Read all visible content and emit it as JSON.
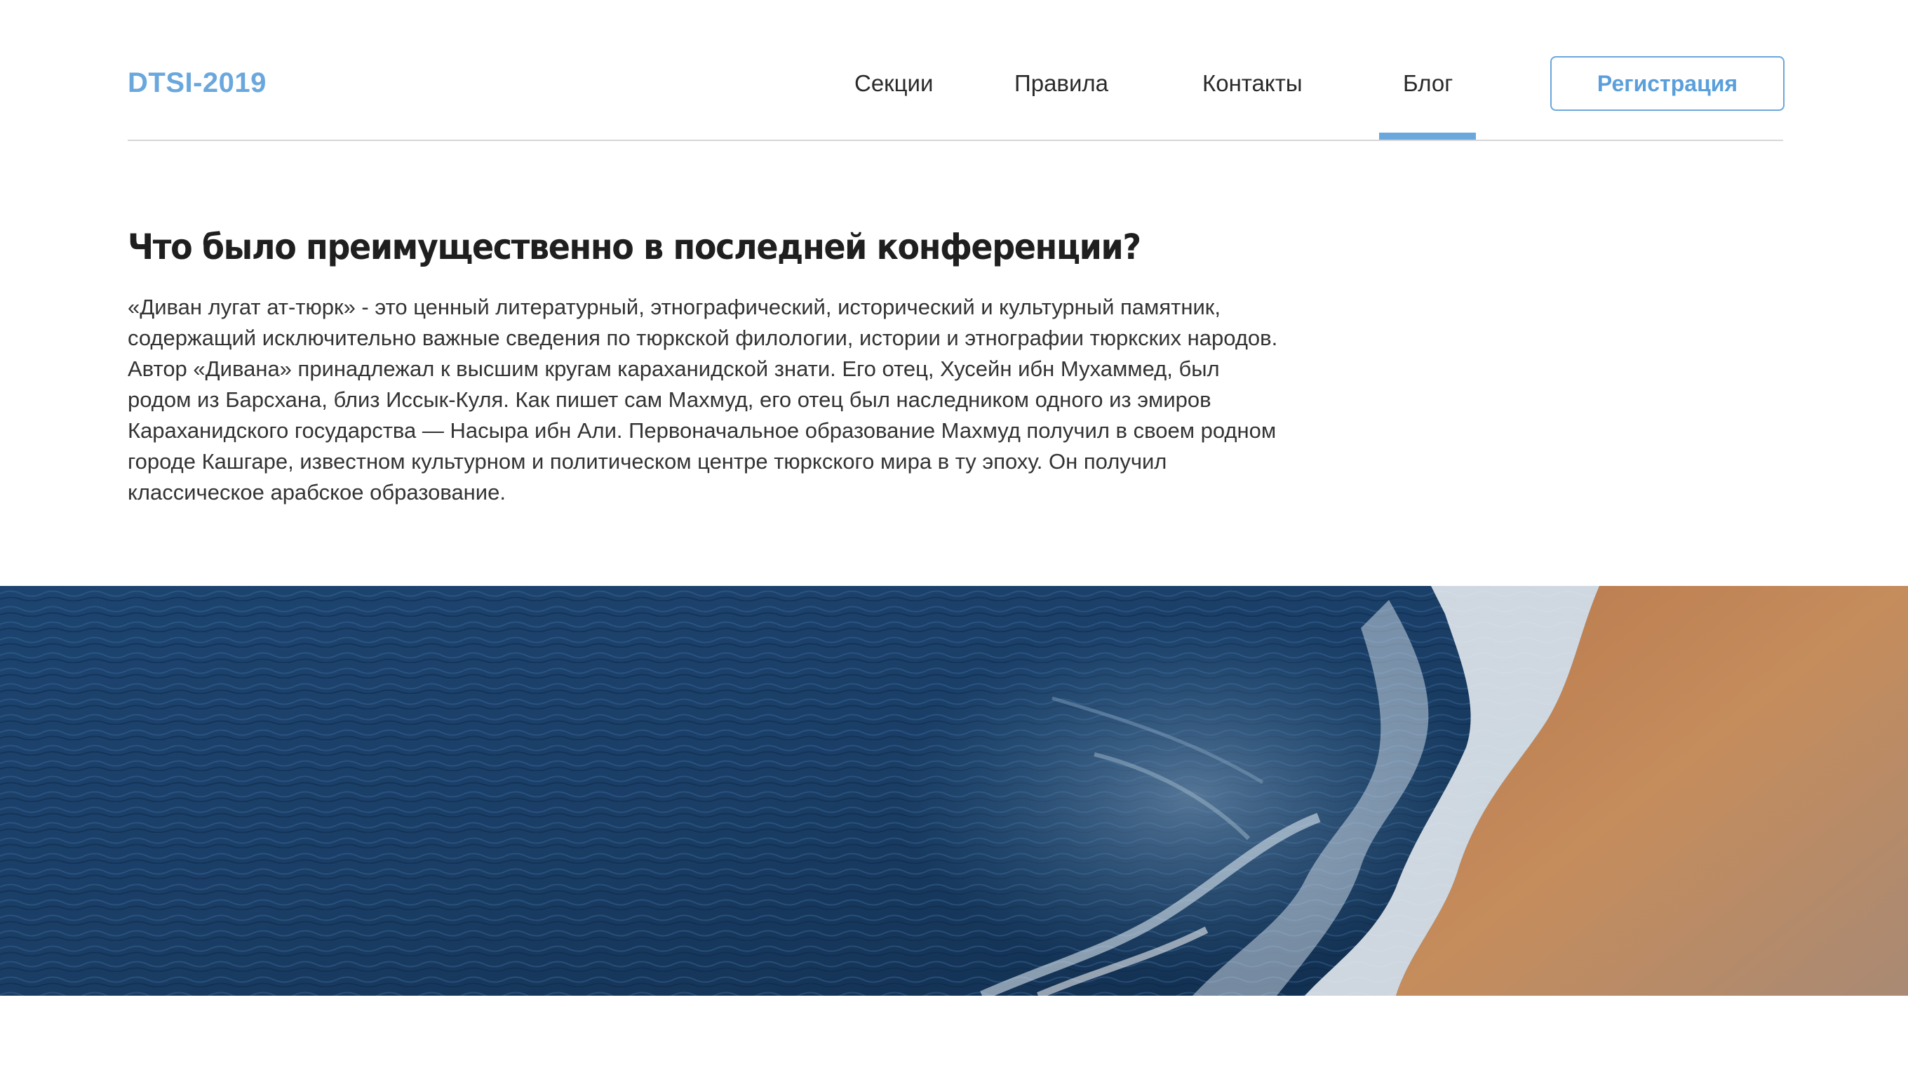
{
  "header": {
    "logo": "DTSI-2019",
    "nav": [
      {
        "label": "Секции"
      },
      {
        "label": "Правила"
      },
      {
        "label": "Контакты"
      },
      {
        "label": "Блог",
        "active": true
      }
    ],
    "register_label": "Регистрация"
  },
  "article": {
    "title": "Что было преимущественно в последней конференции?",
    "body": "«Диван лугат ат-тюрк» - это ценный литературный, этнографический, исторический и культурный памятник, содержащий исключительно важные сведения по тюркской филологии, истории и этнографии тюркских народов.  Автор «Дивана» принадлежал к высшим кругам караханидской знати. Его отец, Хусейн ибн Мухаммед, был родом из Барсхана, близ Иссык-Куля. Как пишет сам Махмуд, его отец был наследником одного из эмиров Караханидского государства — Насыра ибн Али. Первоначальное образование Махмуд получил в своем родном городе Кашгаре, известном культурном и политическом центре тюркского мира в ту эпоху. Он получил классическое арабское образование."
  },
  "colors": {
    "accent": "#6aa7dc",
    "text": "#333333",
    "heading": "#1f1f1f",
    "divider": "#d6d6d6",
    "ocean_deep": "#16355a",
    "ocean_mid": "#2b5680",
    "sand": "#c38a5a"
  },
  "hero_image": {
    "icon": "ocean-beach-aerial-image"
  }
}
